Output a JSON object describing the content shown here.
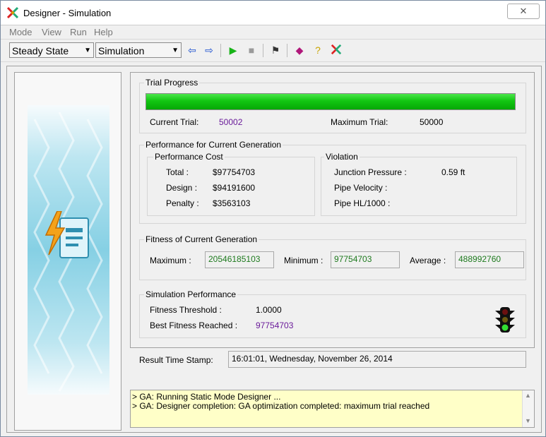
{
  "window": {
    "title": "Designer - Simulation",
    "close_glyph": "✕"
  },
  "menu": [
    "Mode",
    "View",
    "Run",
    "Help"
  ],
  "toolbar": {
    "mode_combo": "Steady State",
    "view_combo": "Simulation",
    "buttons": [
      "back-arrow-icon",
      "forward-arrow-icon",
      "play-icon",
      "stop-icon",
      "flag-icon",
      "book-icon",
      "help-icon",
      "designer-logo-icon"
    ]
  },
  "trial_progress": {
    "title": "Trial Progress",
    "progress_fraction": 1.0,
    "current_label": "Current Trial:",
    "current_value": "50002",
    "max_label": "Maximum Trial:",
    "max_value": "50000"
  },
  "performance": {
    "title": "Performance for Current Generation",
    "cost": {
      "title": "Performance Cost",
      "rows": [
        {
          "label": "Total :",
          "value": "$97754703"
        },
        {
          "label": "Design :",
          "value": "$94191600"
        },
        {
          "label": "Penalty :",
          "value": "$3563103"
        }
      ]
    },
    "violation": {
      "title": "Violation",
      "rows": [
        {
          "label": "Junction Pressure :",
          "value": "0.59 ft"
        },
        {
          "label": "Pipe Velocity :",
          "value": ""
        },
        {
          "label": "Pipe HL/1000 :",
          "value": ""
        }
      ]
    }
  },
  "fitness": {
    "title": "Fitness of Current Generation",
    "max_label": "Maximum :",
    "max_value": "20546185103",
    "min_label": "Minimum :",
    "min_value": "97754703",
    "avg_label": "Average :",
    "avg_value": "488992760"
  },
  "simulation": {
    "title": "Simulation Performance",
    "threshold_label": "Fitness Threshold :",
    "threshold_value": "1.0000",
    "best_label": "Best Fitness Reached :",
    "best_value": "97754703",
    "indicator": "traffic-light-icon"
  },
  "timestamp": {
    "label": "Result Time Stamp:",
    "value": "16:01:01, Wednesday, November 26, 2014"
  },
  "log": [
    "> GA: Running Static Mode Designer ...",
    "> GA: Designer completion: GA optimization completed: maximum trial reached"
  ]
}
